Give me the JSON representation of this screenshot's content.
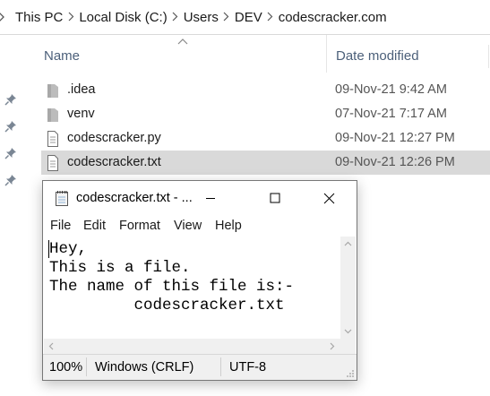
{
  "breadcrumb": {
    "items": [
      "This PC",
      "Local Disk (C:)",
      "Users",
      "DEV",
      "codescracker.com"
    ]
  },
  "columns": {
    "name": "Name",
    "date_modified": "Date modified"
  },
  "files": [
    {
      "name": ".idea",
      "date": "09-Nov-21 9:42 AM",
      "type": "folder"
    },
    {
      "name": "venv",
      "date": "07-Nov-21 7:17 AM",
      "type": "folder"
    },
    {
      "name": "codescracker.py",
      "date": "09-Nov-21 12:27 PM",
      "type": "file"
    },
    {
      "name": "codescracker.txt",
      "date": "09-Nov-21 12:26 PM",
      "type": "file",
      "selected": true
    }
  ],
  "notepad": {
    "title": "codescracker.txt - ...",
    "menu": [
      "File",
      "Edit",
      "Format",
      "View",
      "Help"
    ],
    "content": "Hey,\nThis is a file.\nThe name of this file is:-\n         codescracker.txt",
    "status": {
      "zoom": "100%",
      "line_ending": "Windows (CRLF)",
      "encoding": "UTF-8"
    }
  },
  "icons": {
    "chevron": "chevron-right-icon",
    "pin": "pin-icon",
    "folder": "folder-icon",
    "file": "text-file-icon",
    "notepad": "notepad-app-icon"
  },
  "colors": {
    "selected_row": "#d9d9d9",
    "header_text": "#4c607a",
    "folder_gray": "#bcbcbc"
  }
}
